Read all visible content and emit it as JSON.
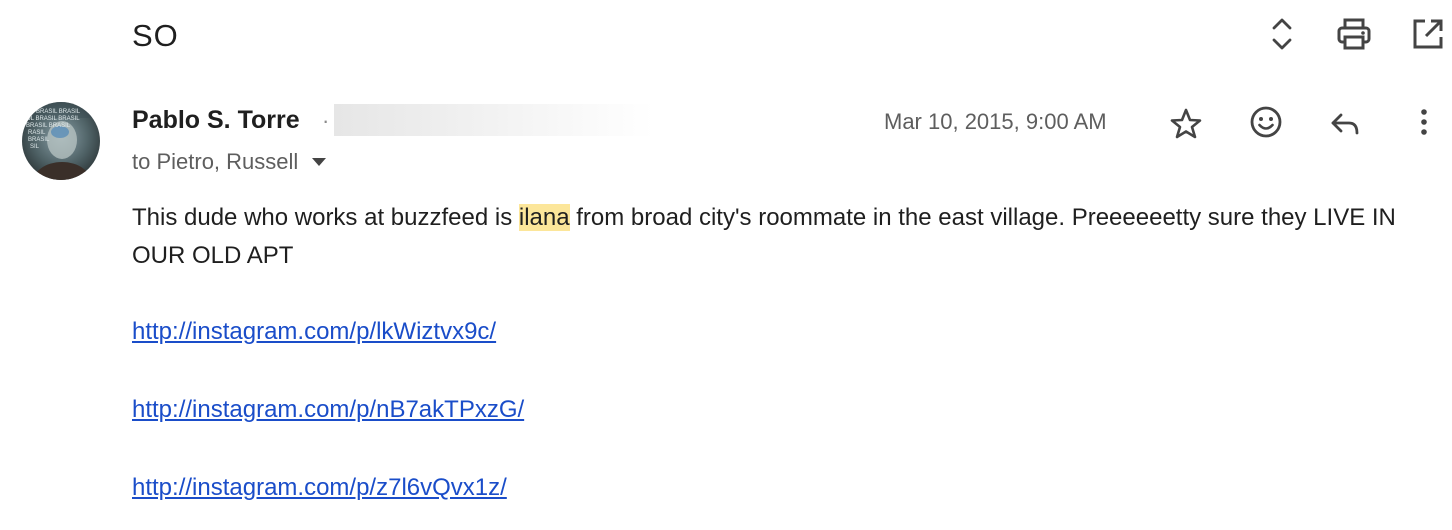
{
  "email": {
    "subject": "SO",
    "sender": {
      "name": "Pablo S. Torre",
      "separator": "·"
    },
    "recipients_label": "to Pietro, Russell",
    "date": "Mar 10, 2015, 9:00 AM",
    "body": {
      "before_highlight": "This dude who works at buzzfeed is ",
      "highlight": "ilana",
      "after_highlight": " from broad city's roommate in the east village. Preeeeeetty sure they LIVE IN OUR OLD APT"
    },
    "links": [
      "http://instagram.com/p/lkWiztvx9c/",
      "http://instagram.com/p/nB7akTPxzG/",
      "http://instagram.com/p/z7l6vQvx1z/"
    ],
    "avatar_text_lines": [
      "BRASIL BRASIL",
      "OL BRASIL BRASIL",
      "BRASIL BRASIL",
      "RASIL",
      "BRASIL",
      "SIL"
    ]
  },
  "icons": {
    "expand": "unfold-icon",
    "print": "print-icon",
    "open_new_window": "open-in-new-icon",
    "star": "star-icon",
    "emoji": "emoji-icon",
    "reply": "reply-icon",
    "more": "more-vert-icon"
  },
  "colors": {
    "link": "#1a4dc9",
    "highlight": "#fce69a",
    "text": "#1f1f1f",
    "secondary_text": "#5e5e5e"
  }
}
